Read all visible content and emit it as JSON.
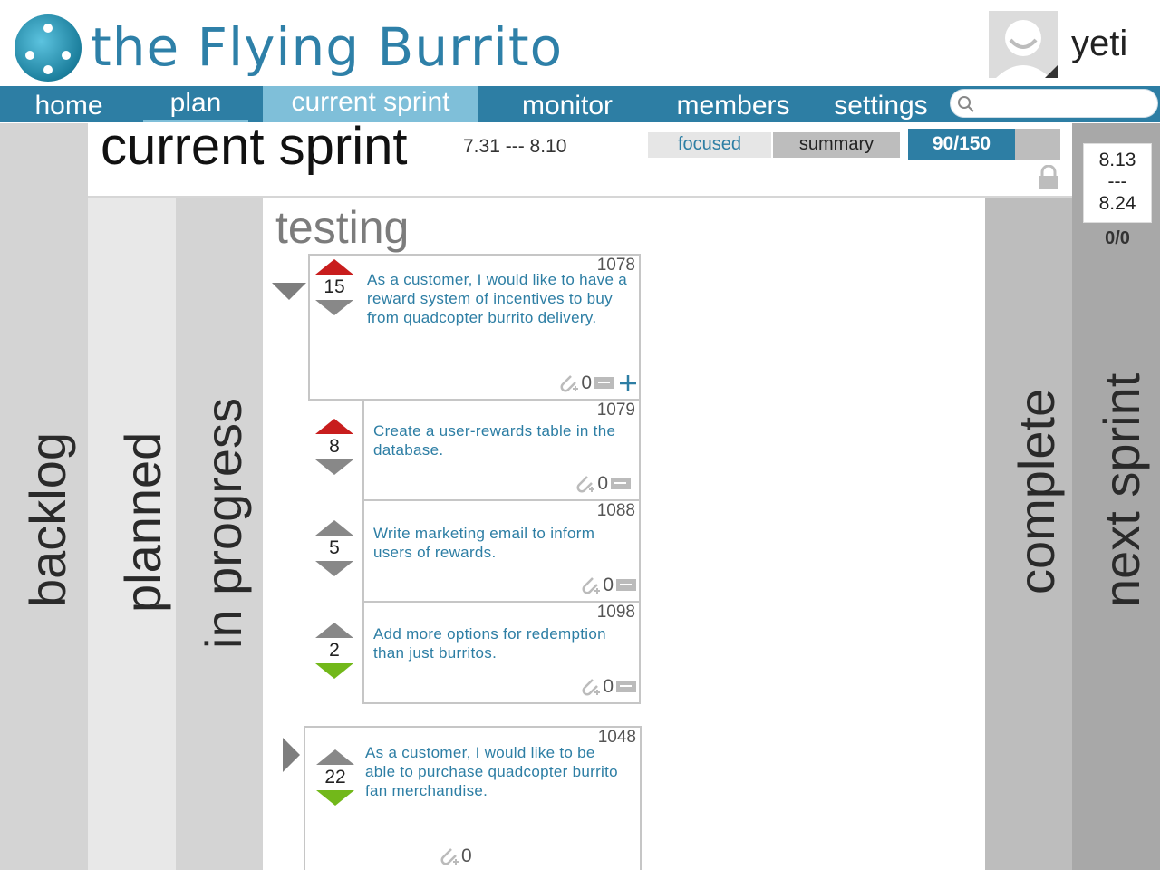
{
  "app": {
    "title": "the Flying Burrito",
    "username": "yeti"
  },
  "nav": {
    "items": [
      {
        "label": "home"
      },
      {
        "label": "plan"
      },
      {
        "label": "current sprint"
      },
      {
        "label": "monitor"
      },
      {
        "label": "members"
      },
      {
        "label": "settings"
      }
    ],
    "active": "current sprint",
    "search_placeholder": ""
  },
  "lanes": {
    "backlog": "backlog",
    "planned": "planned",
    "in_progress": "in progress",
    "complete": "complete",
    "next_sprint": "next sprint"
  },
  "sprint": {
    "title": "current sprint",
    "dates": "7.31 --- 8.10",
    "tabs": {
      "focused": "focused",
      "summary": "summary"
    },
    "points": "90/150",
    "points_fraction": 0.6
  },
  "next_sprint": {
    "start": "8.13",
    "sep": "---",
    "end": "8.24",
    "count": "0/0"
  },
  "testing": {
    "title": "testing",
    "stories": [
      {
        "id": "1078",
        "text": "As a customer, I would like to have a reward system of incentives to buy from quadcopter burrito delivery.",
        "points": "15",
        "up": "red",
        "down": "gray",
        "attachments": "0",
        "expanded": true
      },
      {
        "id": "1048",
        "text": "As a customer, I would like to be able to purchase quadcopter burrito fan merchandise.",
        "points": "22",
        "up": "gray",
        "down": "green",
        "attachments": "0",
        "expanded": false
      }
    ],
    "tasks": [
      {
        "id": "1079",
        "text": "Create a user-rewards table in the database.",
        "points": "8",
        "up": "red",
        "down": "gray",
        "attachments": "0"
      },
      {
        "id": "1088",
        "text": "Write marketing email to inform users of rewards.",
        "points": "5",
        "up": "gray",
        "down": "gray",
        "attachments": "0"
      },
      {
        "id": "1098",
        "text": "Add more options for redemption than just burritos.",
        "points": "2",
        "up": "gray",
        "down": "green",
        "attachments": "0"
      }
    ]
  },
  "icons": {
    "expand": "triangle-down-icon",
    "collapse": "triangle-right-icon",
    "attachment": "paperclip-icon",
    "comment": "comment-icon",
    "add": "plus-icon",
    "lock": "lock-icon",
    "search": "search-icon"
  }
}
